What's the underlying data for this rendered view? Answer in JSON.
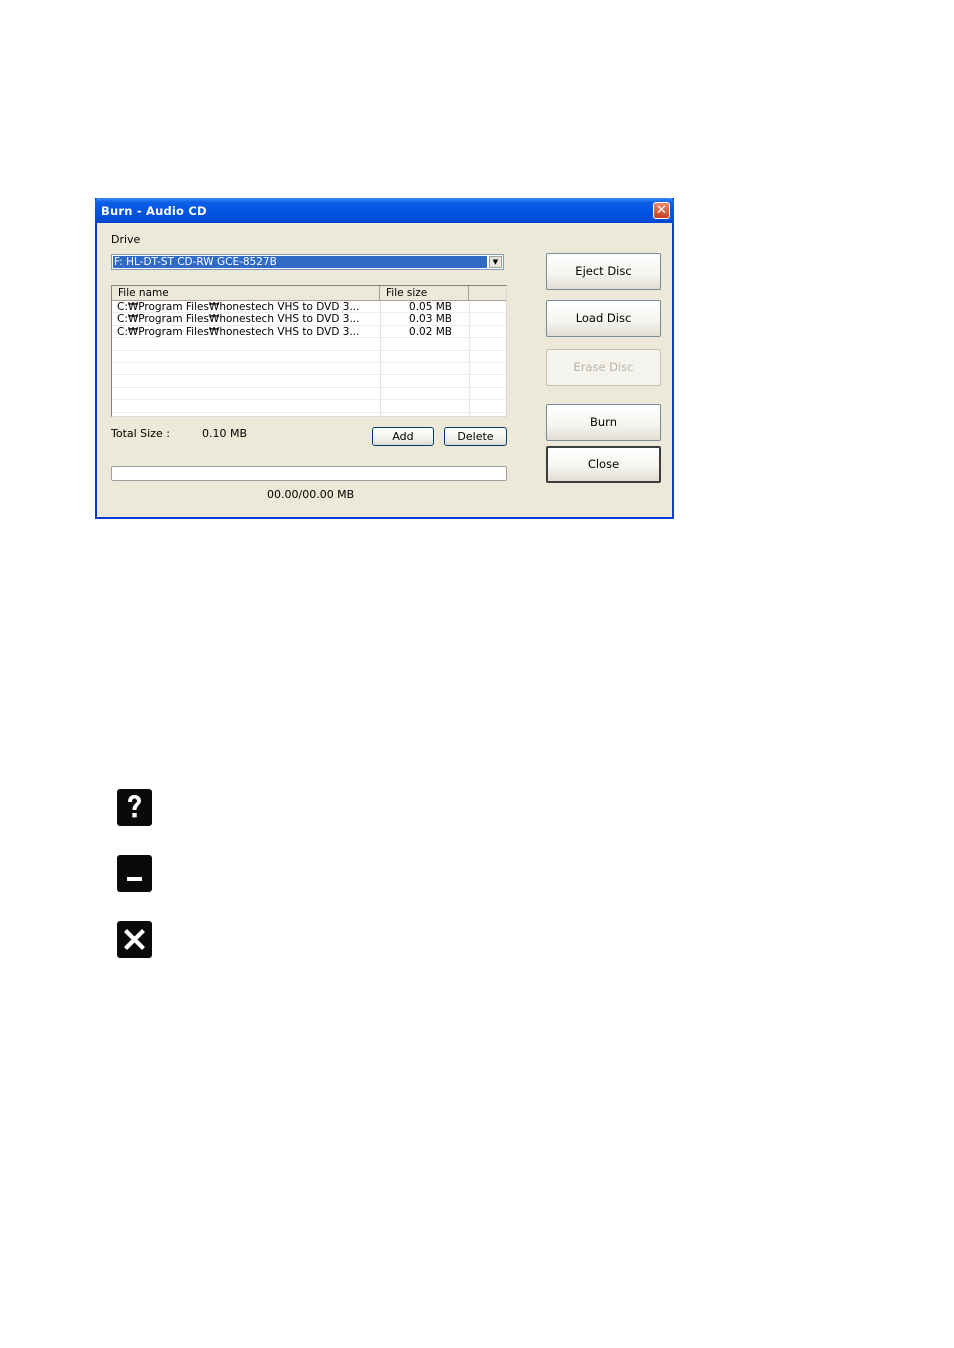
{
  "dialog": {
    "title": "Burn - Audio CD",
    "close_glyph": "✕",
    "drive_label": "Drive",
    "drive_value": "F: HL-DT-ST CD-RW GCE-8527B",
    "list": {
      "headers": {
        "name": "File name",
        "size": "File size"
      },
      "rows": [
        {
          "name": "C:₩Program Files₩honestech VHS to DVD 3...",
          "size": "0.05 MB"
        },
        {
          "name": "C:₩Program Files₩honestech VHS to DVD 3...",
          "size": "0.03 MB"
        },
        {
          "name": "C:₩Program Files₩honestech VHS to DVD 3...",
          "size": "0.02 MB"
        }
      ]
    },
    "total_size_label": "Total Size :",
    "total_size_value": "0.10 MB",
    "add_label": "Add",
    "delete_label": "Delete",
    "progress_text": "00.00/00.00 MB",
    "progress_fraction": 0,
    "buttons": {
      "eject": "Eject Disc",
      "load": "Load Disc",
      "erase": "Erase Disc",
      "burn": "Burn",
      "close": "Close"
    }
  },
  "icons": [
    {
      "name": "help-icon"
    },
    {
      "name": "minimize-icon"
    },
    {
      "name": "close-icon"
    }
  ],
  "colors": {
    "titlebar": "#0054e3",
    "selection": "#316ac5",
    "dialog_bg": "#ece9d8",
    "close_red": "#c8401c"
  }
}
